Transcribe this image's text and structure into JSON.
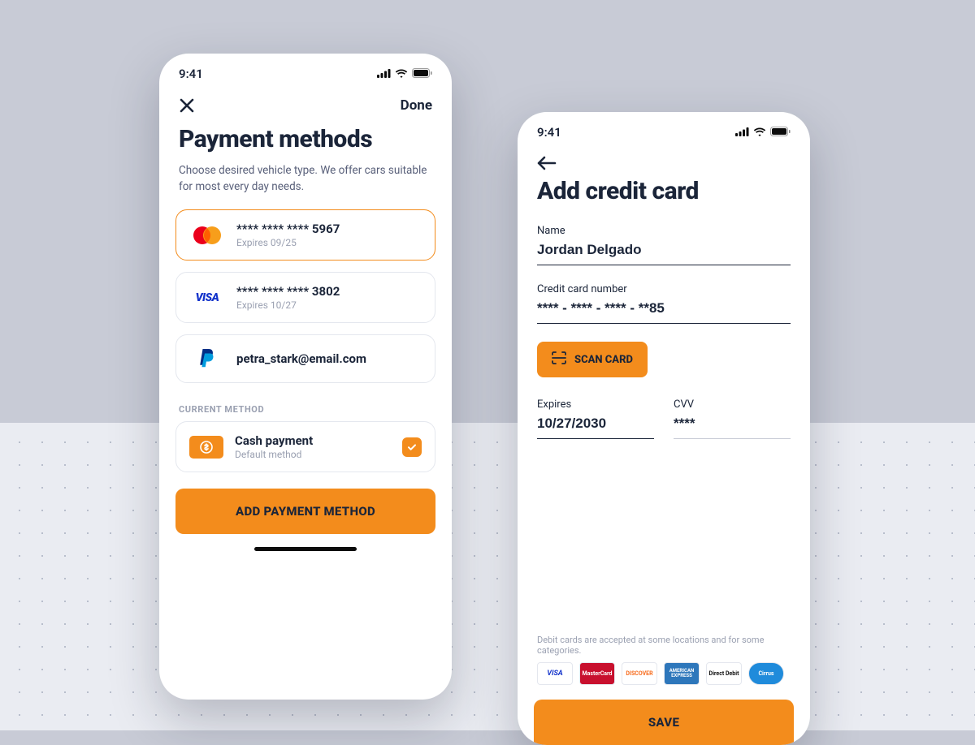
{
  "statusTime": "9:41",
  "left": {
    "topbar": {
      "done_label": "Done"
    },
    "title": "Payment methods",
    "subtitle": "Choose desired vehicle type. We offer cars suitable for most every day needs.",
    "cards": [
      {
        "number": "**** **** **** 5967",
        "expiry": "Expires 09/25",
        "brand": "mastercard"
      },
      {
        "number": "**** **** **** 3802",
        "expiry": "Expires 10/27",
        "brand": "visa"
      },
      {
        "number": "petra_stark@email.com",
        "expiry": "",
        "brand": "paypal"
      }
    ],
    "section_label": "CURRENT METHOD",
    "cash": {
      "title": "Cash payment",
      "sub": "Default method"
    },
    "add_button_label": "ADD PAYMENT METHOD"
  },
  "right": {
    "title": "Add credit card",
    "fields": {
      "name_label": "Name",
      "name_value": "Jordan Delgado",
      "ccnum_label": "Credit card number",
      "ccnum_value": "**** - **** - **** - **85",
      "expires_label": "Expires",
      "expires_value": "10/27/2030",
      "cvv_label": "CVV",
      "cvv_value": "****"
    },
    "scan_label": "SCAN CARD",
    "disclaimer": "Debit cards are accepted at some locations and for some categories.",
    "brands": [
      "VISA",
      "MasterCard",
      "DISCOVER",
      "AMERICAN EXPRESS",
      "Direct Debit",
      "Cirrus"
    ],
    "save_label": "SAVE"
  },
  "colors": {
    "accent": "#F38C1C"
  }
}
